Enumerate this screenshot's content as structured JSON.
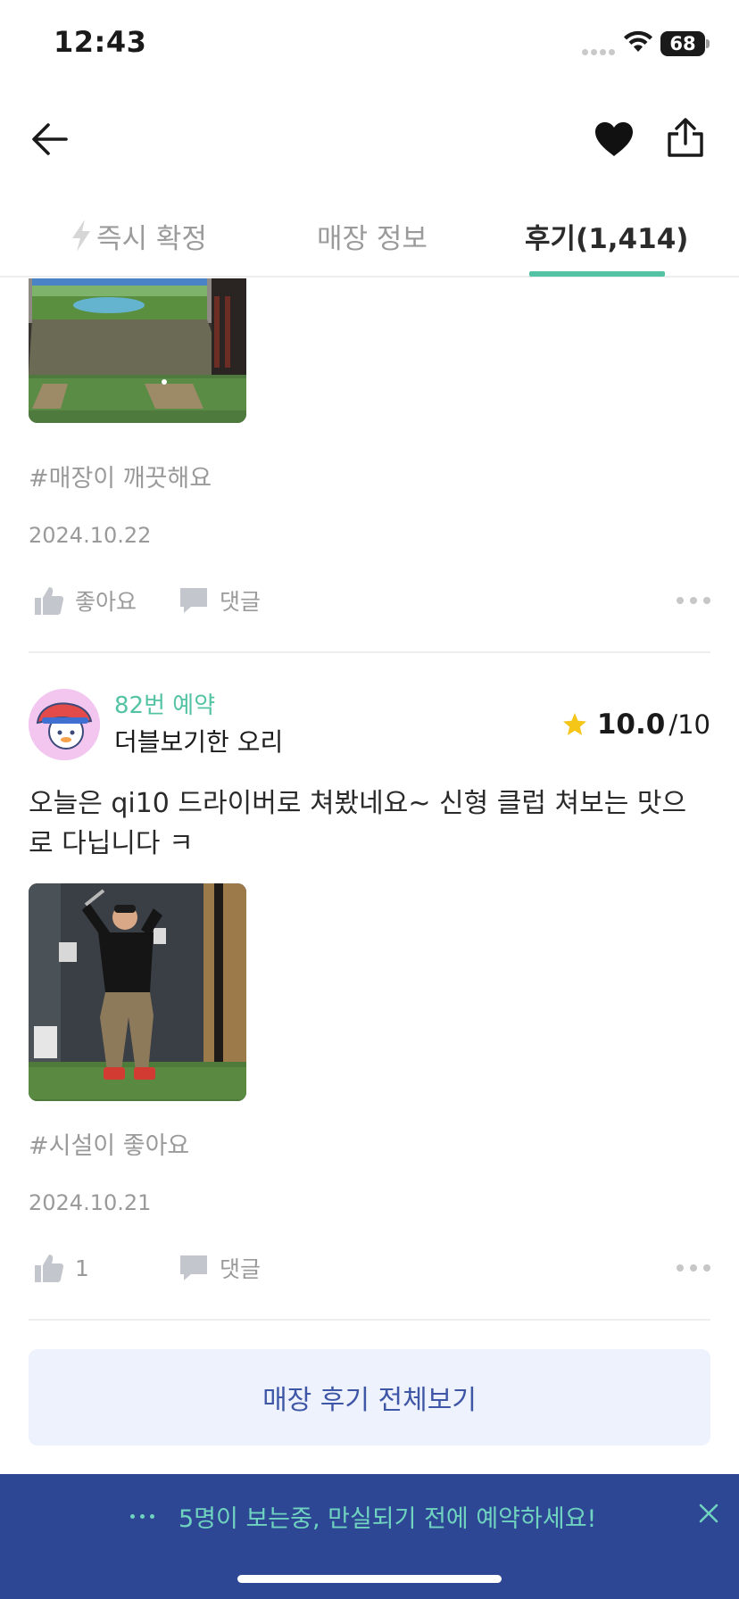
{
  "status_bar": {
    "time": "12:43",
    "battery": "68"
  },
  "nav": {
    "back_icon": "arrow-left-icon",
    "heart_icon": "heart-filled-icon",
    "share_icon": "share-icon"
  },
  "tabs": [
    {
      "label": "즉시 확정",
      "icon": "lightning-icon",
      "active": false
    },
    {
      "label": "매장 정보",
      "active": false
    },
    {
      "label": "후기(1,414)",
      "active": true
    }
  ],
  "reviews": [
    {
      "photo": "golf-simulator-room-photo",
      "tag": "#매장이 깨끗해요",
      "date": "2024.10.22",
      "like_label": "좋아요",
      "comment_label": "댓글"
    },
    {
      "booking_count": "82번 예약",
      "nickname": "더블보기한 오리",
      "rating": "10.0",
      "rating_max": "/10",
      "text": "오늘은 qi10 드라이버로 쳐봤네요~ 신형 클럽 쳐보는 맛으로 다닙니다 ㅋ",
      "photo": "golfer-swing-photo",
      "tag": "#시설이 좋아요",
      "date": "2024.10.21",
      "like_label": "1",
      "comment_label": "댓글"
    }
  ],
  "all_reviews_button": "매장 후기 전체보기",
  "banner": {
    "text": "5명이 보는중, 만실되기 전에 예약하세요!",
    "close_icon": "close-icon"
  },
  "colors": {
    "accent": "#54c3a4",
    "banner_bg": "#2d4794",
    "button_bg": "#eef2fd",
    "button_text": "#3e56a6",
    "star": "#f5c518"
  }
}
